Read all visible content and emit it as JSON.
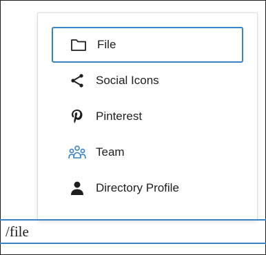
{
  "popover": {
    "items": [
      {
        "label": "File",
        "icon": "folder-icon",
        "selected": true
      },
      {
        "label": "Social Icons",
        "icon": "share-icon",
        "selected": false
      },
      {
        "label": "Pinterest",
        "icon": "pinterest-icon",
        "selected": false
      },
      {
        "label": "Team",
        "icon": "team-icon",
        "selected": false
      },
      {
        "label": "Directory Profile",
        "icon": "person-icon",
        "selected": false
      }
    ]
  },
  "editor": {
    "input_text": "/file"
  },
  "colors": {
    "accent": "#3582c4",
    "team_icon": "#3582c4",
    "text": "#1e1e1e"
  }
}
